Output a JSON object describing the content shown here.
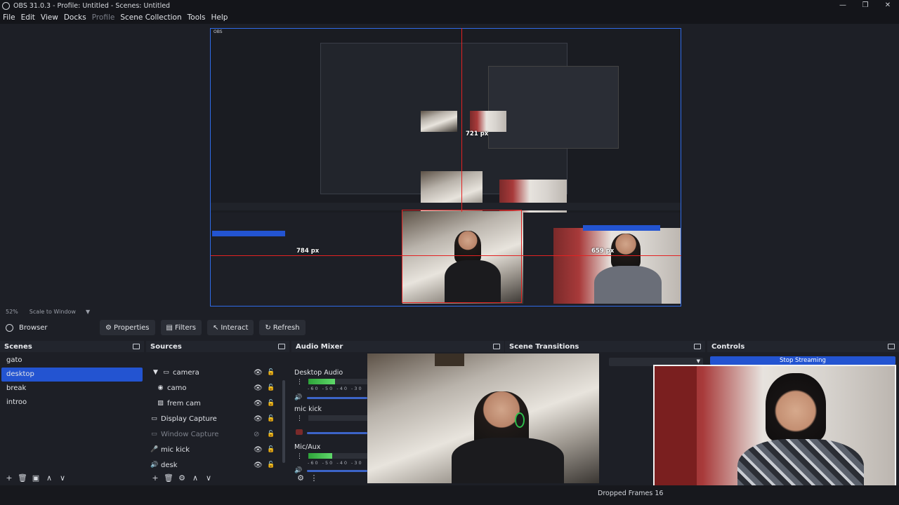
{
  "window": {
    "title": "OBS 31.0.3 - Profile: Untitled - Scenes: Untitled",
    "controls": [
      "—",
      "❐",
      "✕"
    ]
  },
  "menu": {
    "items": [
      {
        "label": "File",
        "disabled": false
      },
      {
        "label": "Edit",
        "disabled": false
      },
      {
        "label": "View",
        "disabled": false
      },
      {
        "label": "Docks",
        "disabled": false
      },
      {
        "label": "Profile",
        "disabled": true
      },
      {
        "label": "Scene Collection",
        "disabled": false
      },
      {
        "label": "Tools",
        "disabled": false
      },
      {
        "label": "Help",
        "disabled": false
      }
    ]
  },
  "preview": {
    "measure_vertical": "721 px",
    "measure_horizontal": "784 px",
    "measure_right": "659 px"
  },
  "scale": {
    "percent": "52%",
    "mode": "Scale to Window"
  },
  "toolbar": {
    "source_label": "Browser",
    "properties": "Properties",
    "filters": "Filters",
    "interact": "Interact",
    "refresh": "Refresh"
  },
  "scenes": {
    "title": "Scenes",
    "items": [
      "gato",
      "desktop",
      "break",
      "introo"
    ],
    "selected_index": 1
  },
  "sources": {
    "title": "Sources",
    "items": [
      {
        "label": "camera",
        "icon": "folder-icon",
        "indent": 1,
        "expanded": true,
        "visible": true
      },
      {
        "label": "camo",
        "icon": "camera-icon",
        "indent": 2,
        "visible": true
      },
      {
        "label": "frem cam",
        "icon": "image-icon",
        "indent": 2,
        "visible": true
      },
      {
        "label": "Display Capture",
        "icon": "display-icon",
        "indent": 0,
        "visible": true
      },
      {
        "label": "Window Capture",
        "icon": "window-icon",
        "indent": 0,
        "visible": false
      },
      {
        "label": "mic kick",
        "icon": "mic-icon",
        "indent": 0,
        "visible": true
      },
      {
        "label": "desk",
        "icon": "speaker-icon",
        "indent": 0,
        "visible": true
      }
    ]
  },
  "audio_mixer": {
    "title": "Audio Mixer",
    "channels": [
      {
        "name": "Desktop Audio",
        "level": 0.45,
        "ticks": "-60 -50 -40 -30"
      },
      {
        "name": "mic kick",
        "level": 0.0,
        "ticks": "-60 -50 -40 -30"
      },
      {
        "name": "Mic/Aux",
        "level": 0.4,
        "ticks": "-60 -50 -40 -30"
      }
    ]
  },
  "scene_transitions": {
    "title": "Scene Transitions"
  },
  "controls": {
    "title": "Controls",
    "stop_streaming": "Stop Streaming"
  },
  "status": {
    "dropped_frames": "Dropped Frames 16"
  },
  "colors": {
    "accent": "#2354d1",
    "guide": "#e32222",
    "background": "#1d1f26"
  }
}
